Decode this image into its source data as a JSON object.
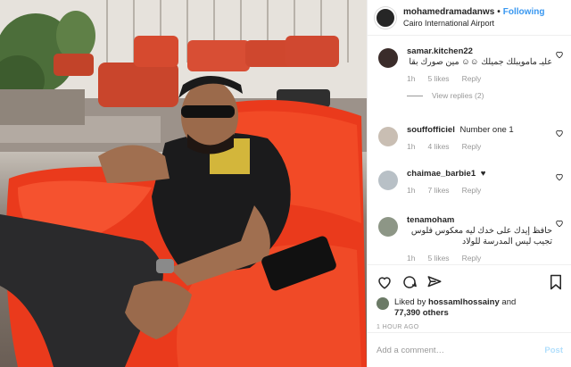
{
  "post": {
    "username": "mohamedramadanws",
    "follow_label": "Following",
    "location": "Cairo International Airport"
  },
  "comments": [
    {
      "username": "samar.kitchen22",
      "text": "عليـ مامويبلك جميلك ☺☺ مين صورك بقا",
      "time": "1h",
      "likes": "5 likes",
      "reply": "Reply",
      "view_replies": "View replies (2)"
    },
    {
      "username": "souffofficiel",
      "text": "Number one 1",
      "time": "1h",
      "likes": "4 likes",
      "reply": "Reply"
    },
    {
      "username": "chaimae_barbie1",
      "text": "♥",
      "time": "1h",
      "likes": "7 likes",
      "reply": "Reply"
    },
    {
      "username": "tenamoham",
      "text": "حافظ إيدك على خدك ليه معكوس فلوس تجيب ليس المدرسة للولاد",
      "time": "1h",
      "likes": "5 likes",
      "reply": "Reply"
    }
  ],
  "likes": {
    "prefix": "Liked by",
    "user": "hossamlhossainy",
    "and": "and",
    "others": "77,390 others"
  },
  "timestamp": "1 HOUR AGO",
  "add_comment": {
    "placeholder": "Add a comment…",
    "post_label": "Post"
  },
  "colors": {
    "accent": "#3897f0",
    "post_disabled": "#b2dffc",
    "muted": "#999999"
  }
}
